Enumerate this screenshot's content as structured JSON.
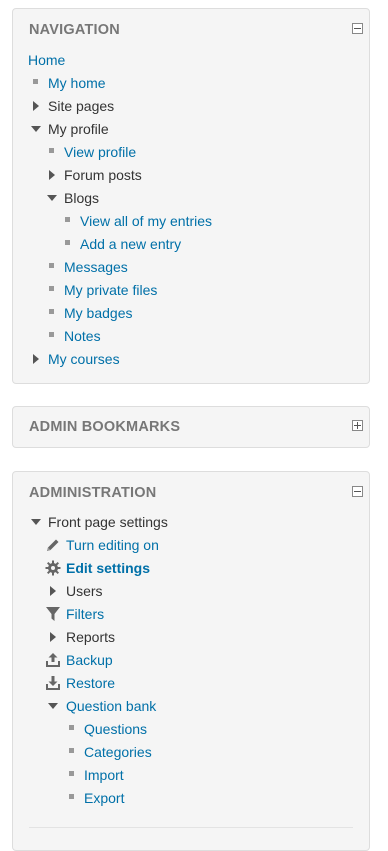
{
  "navigation": {
    "title": "NAVIGATION",
    "home": "Home",
    "my_home": "My home",
    "site_pages": "Site pages",
    "my_profile": "My profile",
    "view_profile": "View profile",
    "forum_posts": "Forum posts",
    "blogs": "Blogs",
    "view_all_entries": "View all of my entries",
    "add_new_entry": "Add a new entry",
    "messages": "Messages",
    "my_private_files": "My private files",
    "my_badges": "My badges",
    "notes": "Notes",
    "my_courses": "My courses"
  },
  "admin_bookmarks": {
    "title": "ADMIN BOOKMARKS"
  },
  "administration": {
    "title": "ADMINISTRATION",
    "front_page_settings": "Front page settings",
    "turn_editing_on": "Turn editing on",
    "edit_settings": "Edit settings",
    "users": "Users",
    "filters": "Filters",
    "reports": "Reports",
    "backup": "Backup",
    "restore": "Restore",
    "question_bank": "Question bank",
    "questions": "Questions",
    "categories": "Categories",
    "import": "Import",
    "export": "Export"
  },
  "colors": {
    "link": "#0070a8",
    "block_bg": "#f5f5f5",
    "title": "#777777"
  },
  "icons": [
    "minus-toggle-icon",
    "plus-toggle-icon",
    "pencil-icon",
    "gear-icon",
    "filter-icon",
    "backup-icon",
    "restore-icon"
  ]
}
